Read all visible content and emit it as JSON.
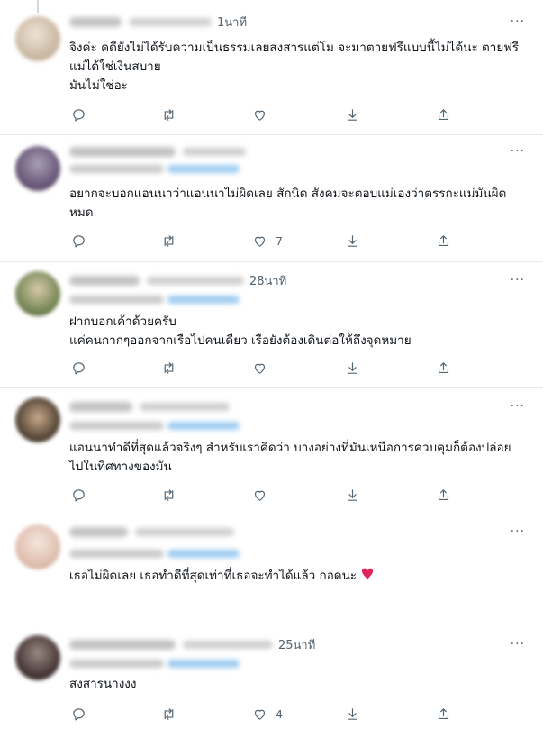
{
  "tweets": [
    {
      "time": "1นาที",
      "text": "จิงค่ะ คดียังไม่ได้รับความเป็นธรรมเลยสงสารแต่โม จะมาตายฟรีแบบนี้ไม่ได้นะ ตายฟรีแม่ได้ใช่เงินสบาย\nมันไม่ใช่อะ",
      "like_count": "",
      "has_reply_line": false,
      "avatar_color": "#d8c8b8"
    },
    {
      "time": "",
      "text": "อยากจะบอกแอนนาว่าแอนนาไม่ผิดเลย สักนิด สังคมจะตอบแม่เองว่าตรรกะแม่มันผิดหมด",
      "like_count": "7",
      "has_reply_line": true,
      "avatar_color": "#6b5a7a"
    },
    {
      "time": "28นาที",
      "text": "ฝากบอกเค้าด้วยครับ\nแค่คนกากๆออกจากเรือไปคนเดียว เรือยังต้องเดินต่อให้ถึงจุดหมาย",
      "like_count": "",
      "has_reply_line": true,
      "avatar_color": "#7a8a5a"
    },
    {
      "time": "",
      "text": "แอนนาทำดีที่สุดแล้วจริงๆ สำหรับเราคิดว่า บางอย่างที่มันเหนือการควบคุมก็ต้องปล่อยไปในทิศทางของมัน",
      "like_count": "",
      "has_reply_line": true,
      "avatar_color": "#5a4a3a"
    },
    {
      "time": "",
      "text": "เธอไม่ผิดเลย เธอทำดีที่สุดเท่าที่เธอจะทำได้แล้ว กอดนะ",
      "emoji": "♥",
      "like_count": "",
      "has_reply_line": true,
      "avatar_color": "#e0c0b0"
    },
    {
      "time": "25นาที",
      "text": "สงสารนางงง",
      "like_count": "4",
      "has_reply_line": true,
      "avatar_color": "#4a3a3a"
    }
  ],
  "icons": {
    "reply": "reply-icon",
    "retweet": "retweet-icon",
    "like": "like-icon",
    "download": "download-icon",
    "share": "share-icon",
    "more": "more-icon"
  },
  "more_label": "···"
}
